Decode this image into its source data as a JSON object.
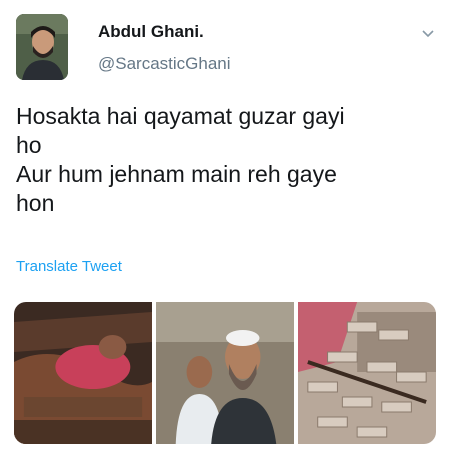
{
  "tweet": {
    "author_name": "Abdul Ghani.",
    "author_handle": "@SarcasticGhani",
    "text": "Hosakta hai qayamat guzar gayi\nho\nAur hum jehnam main reh gaye\nhon",
    "translate_label": "Translate Tweet"
  },
  "icons": {
    "caret": "chevron-down-icon"
  },
  "colors": {
    "link": "#1da1f2",
    "secondary_text": "#657786",
    "primary_text": "#14171a"
  }
}
